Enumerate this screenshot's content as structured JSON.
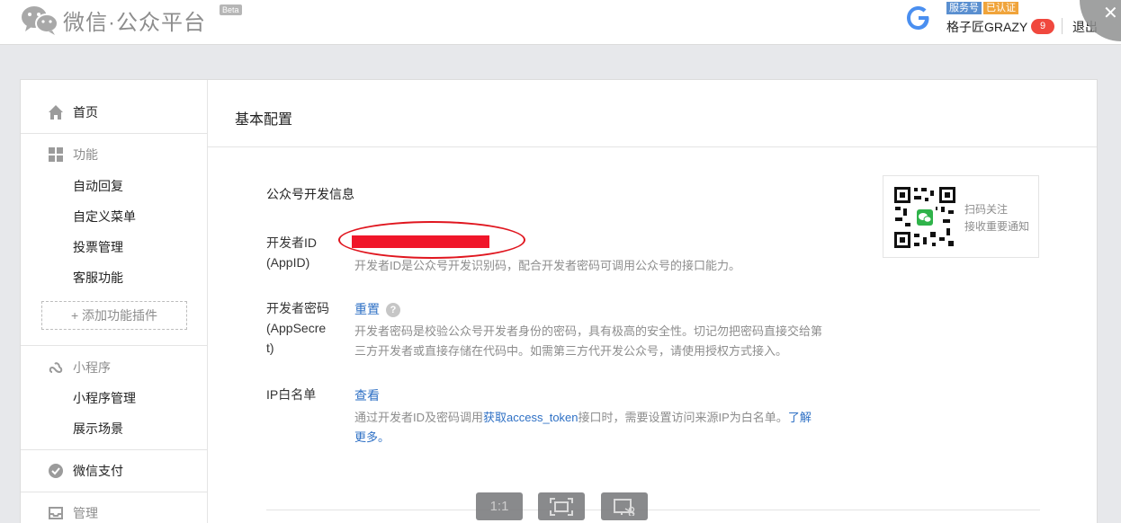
{
  "header": {
    "logo_text": "微信·公众平台",
    "beta": "Beta",
    "badge_service": "服务号",
    "badge_verified": "已认证",
    "username": "格子匠GRAZY",
    "notification_count": "9",
    "logout": "退出"
  },
  "sidebar": {
    "home": "首页",
    "features_head": "功能",
    "features": [
      "自动回复",
      "自定义菜单",
      "投票管理",
      "客服功能"
    ],
    "add_plugin": "添加功能插件",
    "miniprogram_head": "小程序",
    "miniprogram": [
      "小程序管理",
      "展示场景"
    ],
    "wechat_pay": "微信支付",
    "manage": "管理"
  },
  "main": {
    "page_title": "基本配置",
    "section_title": "公众号开发信息",
    "appid_label_1": "开发者ID",
    "appid_label_2": "(AppID)",
    "appid_desc": "开发者ID是公众号开发识别码，配合开发者密码可调用公众号的接口能力。",
    "secret_label_1": "开发者密码",
    "secret_label_2": "(AppSecre",
    "secret_label_3": "t)",
    "secret_reset": "重置",
    "secret_help": "?",
    "secret_desc_1": "开发者密码是校验公众号开发者身份的密码，具有极高的安全性。切记勿把密码直接交给第",
    "secret_desc_2": "三方开发者或直接存储在代码中。如需第三方代开发公众号，请使用授权方式接入。",
    "ip_label": "IP白名单",
    "ip_view": "查看",
    "ip_desc_1a": "通过开发者ID及密码调用",
    "ip_desc_1b": "获取access_token",
    "ip_desc_1c": "接口时，需要设置访问来源IP为白名单。",
    "ip_desc_1d": "了解",
    "ip_desc_2": "更多。",
    "qr_line1": "扫码关注",
    "qr_line2": "接收重要通知"
  },
  "toolbar": {
    "zoom_actual": "1:1",
    "fit_icon": "fit-screen-icon",
    "screenshot_icon": "screenshot-icon"
  },
  "colors": {
    "link": "#2e70c5",
    "redaction": "#f0162a",
    "badge_service": "#5a8fd0",
    "badge_verified": "#f0a43b",
    "notification": "#f0483e"
  }
}
